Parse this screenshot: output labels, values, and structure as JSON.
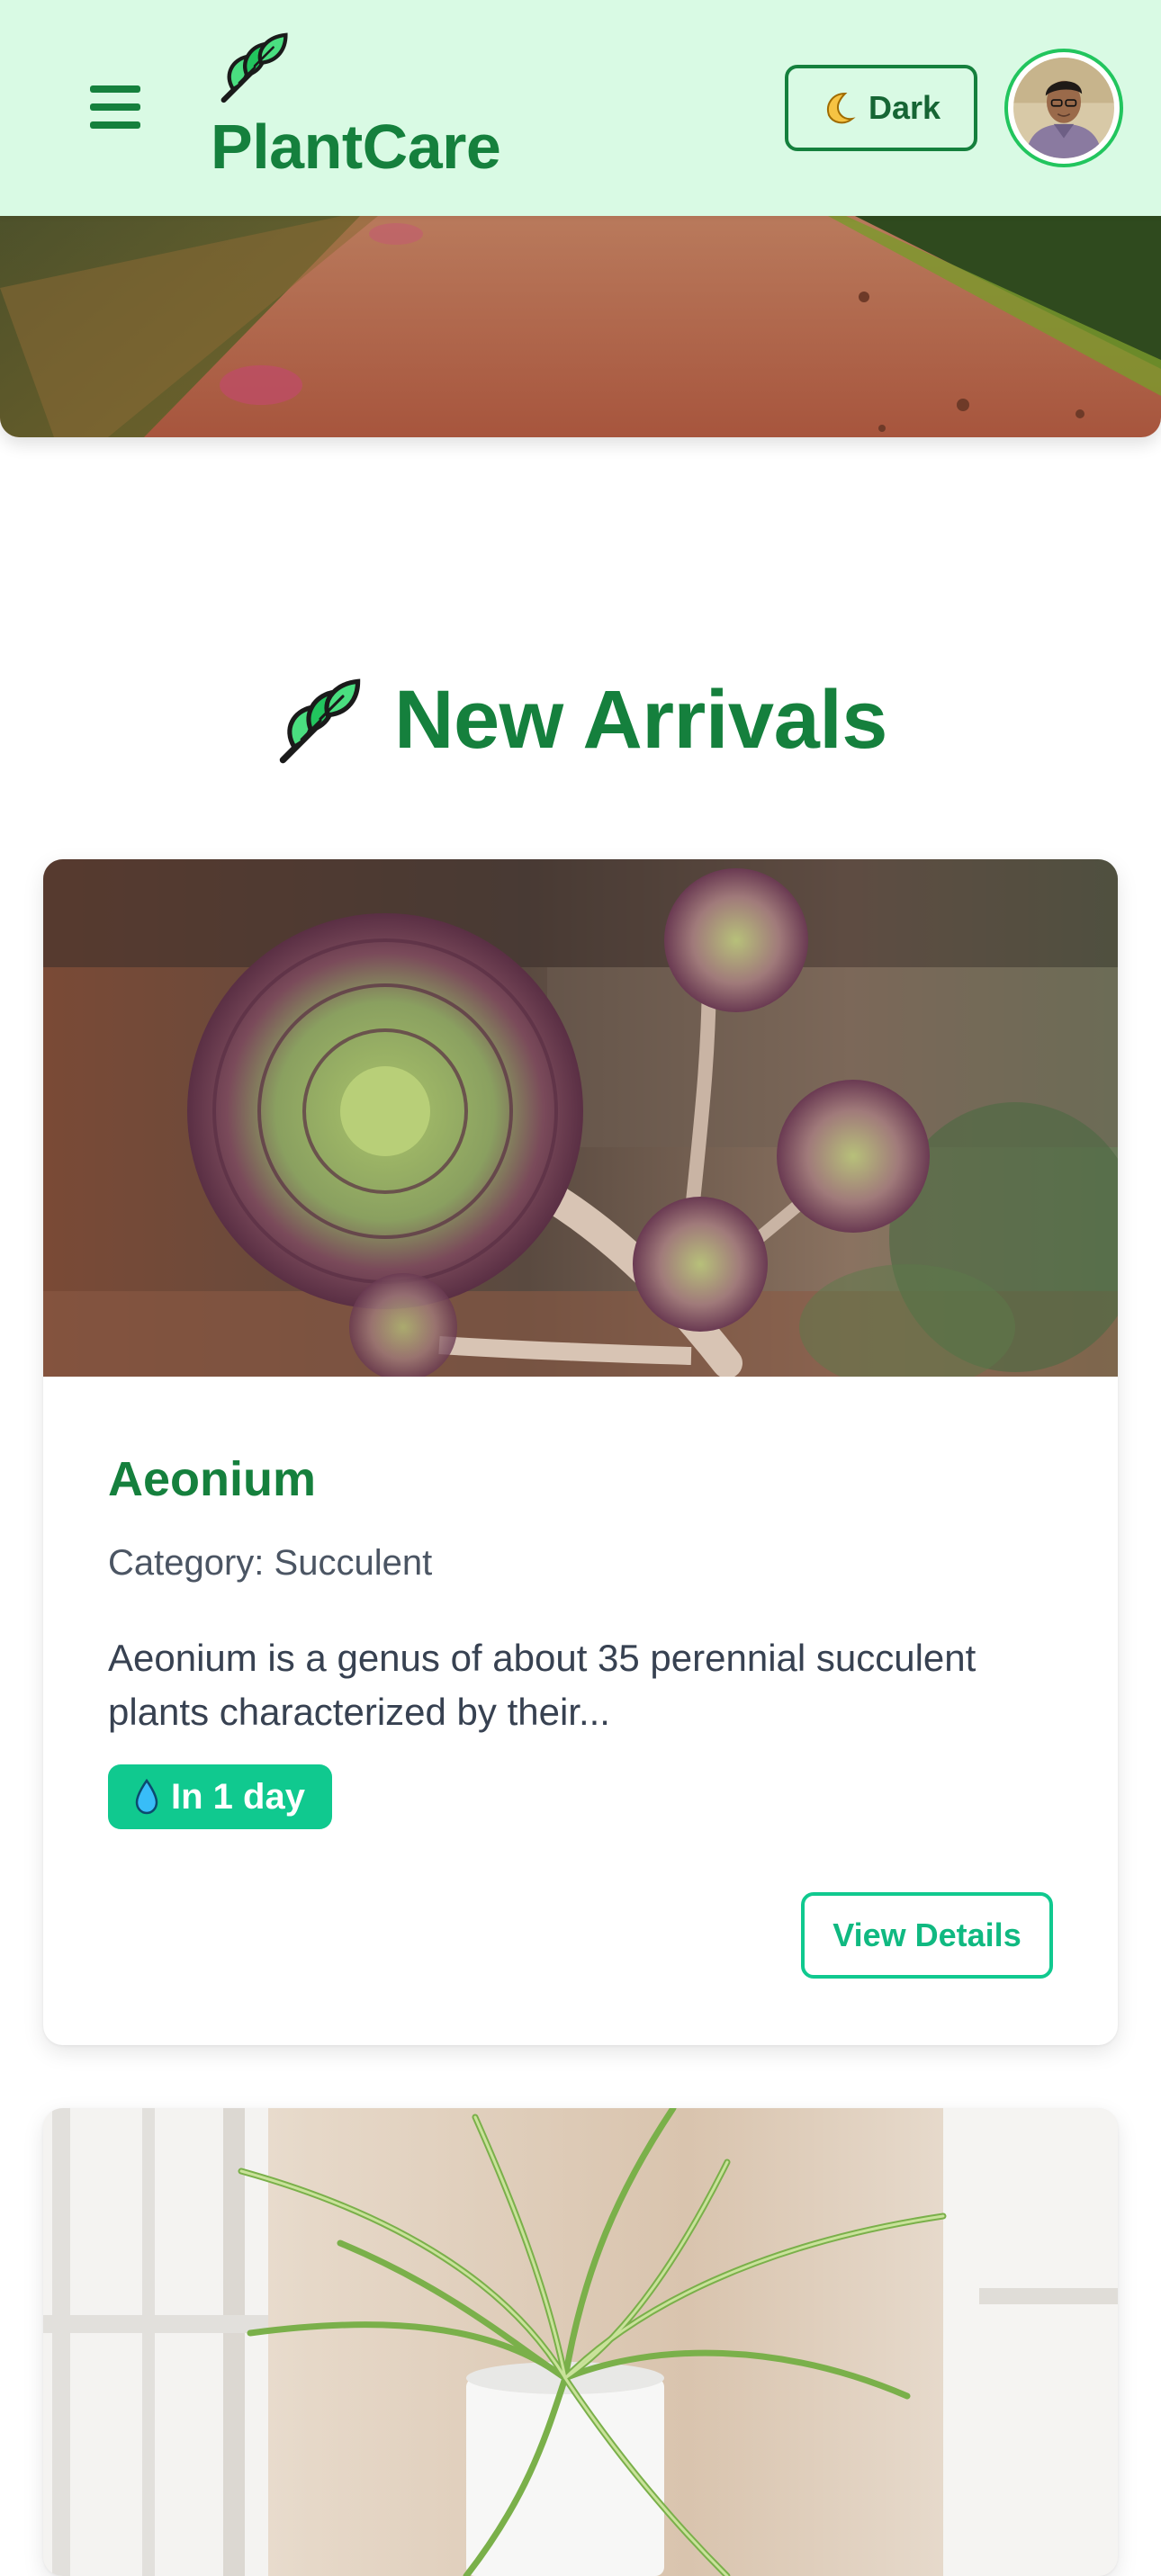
{
  "header": {
    "brand": "PlantCare",
    "theme_toggle_label": "Dark",
    "menu_icon": "hamburger-menu-icon",
    "logo_icon": "herb-leaf-icon",
    "theme_icon": "crescent-moon-icon"
  },
  "section": {
    "title": "New Arrivals",
    "icon": "herb-leaf-icon"
  },
  "cards": [
    {
      "title": "Aeonium",
      "category": "Category: Succulent",
      "description": "Aeonium is a genus of about 35 perennial succulent plants characterized by their...",
      "watering": "In 1 day",
      "watering_icon": "water-drop-icon",
      "action_label": "View Details"
    },
    {
      "title": "",
      "image": "spider-plant-photo"
    }
  ],
  "colors": {
    "header_bg": "#d9fae4",
    "brand_green": "#15803d",
    "accent": "#10c98f"
  }
}
